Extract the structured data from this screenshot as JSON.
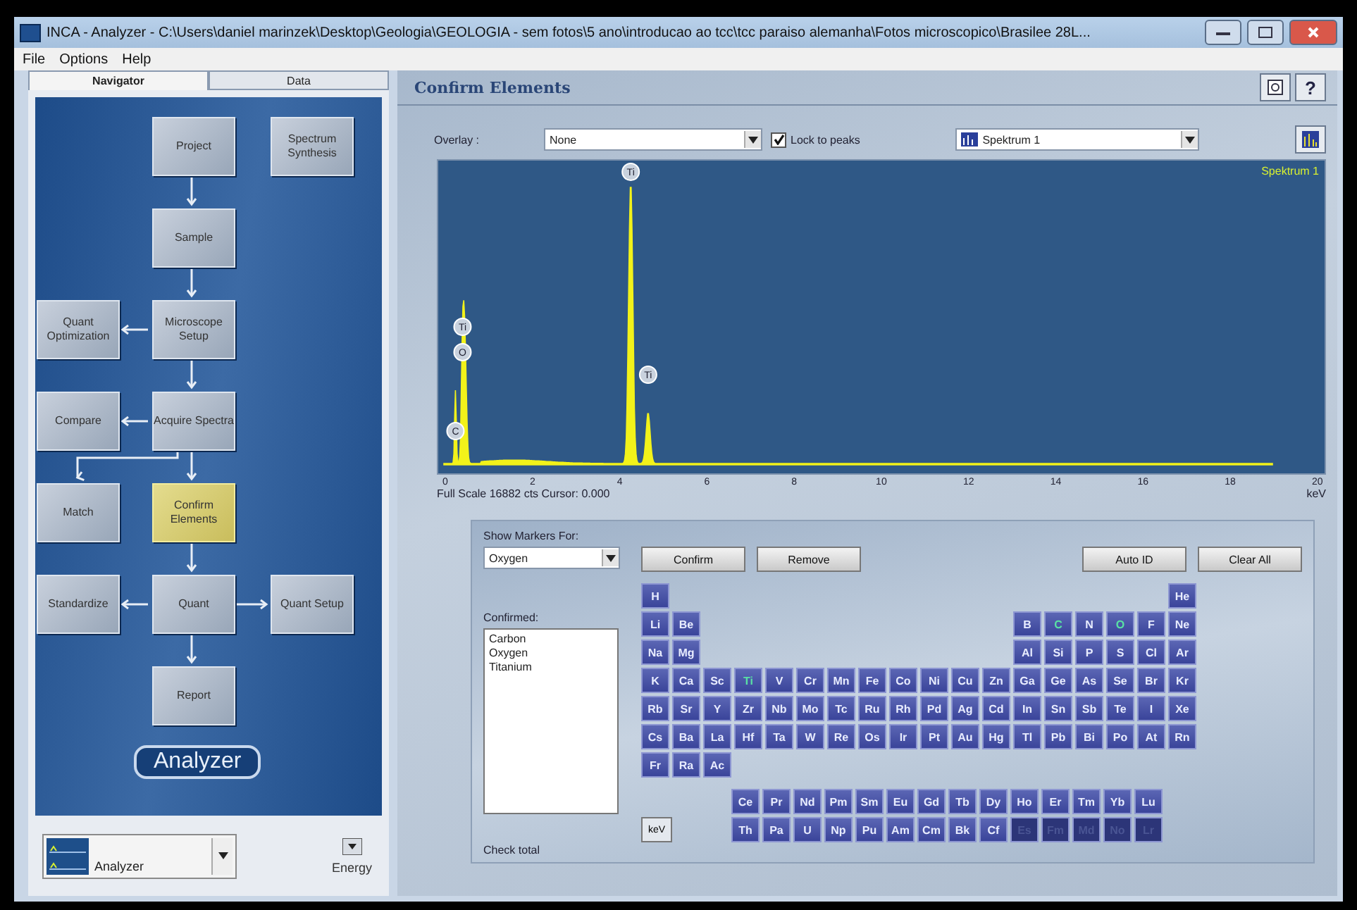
{
  "window": {
    "title": "INCA - Analyzer - C:\\Users\\daniel marinzek\\Desktop\\Geologia\\GEOLOGIA - sem fotos\\5 ano\\introducao ao tcc\\tcc paraiso alemanha\\Fotos microscopico\\Brasilee 28L..."
  },
  "menu": [
    "File",
    "Options",
    "Help"
  ],
  "side_tabs": [
    {
      "label": "Navigator",
      "selected": true
    },
    {
      "label": "Data",
      "selected": false
    }
  ],
  "navigator": {
    "nodes": [
      {
        "label": "Project",
        "selected": false
      },
      {
        "label": "Spectrum Synthesis",
        "selected": false
      },
      {
        "label": "Sample",
        "selected": false
      },
      {
        "label": "Quant Optimization",
        "selected": false
      },
      {
        "label": "Microscope Setup",
        "selected": false
      },
      {
        "label": "Compare",
        "selected": false
      },
      {
        "label": "Acquire Spectra",
        "selected": false
      },
      {
        "label": "Match",
        "selected": false
      },
      {
        "label": "Confirm Elements",
        "selected": true
      },
      {
        "label": "Standardize",
        "selected": false
      },
      {
        "label": "Quant",
        "selected": false
      },
      {
        "label": "Quant Setup",
        "selected": false
      },
      {
        "label": "Report",
        "selected": false
      }
    ],
    "logo": "Analyzer"
  },
  "app_select": "Analyzer",
  "energy_button": "Energy",
  "panel": {
    "title": "Confirm Elements",
    "help": "?"
  },
  "overlay": {
    "label": "Overlay :",
    "value": "None"
  },
  "lock_to_peaks": {
    "label": "Lock to peaks",
    "checked": true
  },
  "spectrum_select": "Spektrum  1",
  "spectrum": {
    "legend": "Spektrum  1",
    "x_ticks": [
      "0",
      "2",
      "4",
      "6",
      "8",
      "10",
      "12",
      "14",
      "16",
      "18",
      "20"
    ],
    "scale": "Full Scale 16882 cts Cursor: 0.000",
    "unit": "keV",
    "peak_labels": [
      {
        "label": "C"
      },
      {
        "label": "O"
      },
      {
        "label": "Ti"
      },
      {
        "label": "Ti"
      },
      {
        "label": "Ti"
      }
    ]
  },
  "markers": {
    "label": "Show Markers For:",
    "value": "Oxygen"
  },
  "buttons": [
    {
      "label": "Confirm"
    },
    {
      "label": "Remove"
    },
    {
      "label": "Auto ID"
    },
    {
      "label": "Clear All"
    }
  ],
  "confirmed": {
    "label": "Confirmed:",
    "items": [
      "Carbon",
      "Oxygen",
      "Titanium"
    ]
  },
  "check_total": "Check total",
  "kev_button": "keV",
  "periodic_table": {
    "rows": [
      [
        {
          "s": "H"
        },
        "",
        "",
        "",
        "",
        "",
        "",
        "",
        "",
        "",
        "",
        "",
        "",
        "",
        "",
        "",
        "",
        {
          "s": "He"
        }
      ],
      [
        {
          "s": "Li"
        },
        {
          "s": "Be"
        },
        "",
        "",
        "",
        "",
        "",
        "",
        "",
        "",
        "",
        "",
        {
          "s": "B"
        },
        {
          "s": "C",
          "confirmed": true
        },
        {
          "s": "N"
        },
        {
          "s": "O",
          "confirmed": true
        },
        {
          "s": "F"
        },
        {
          "s": "Ne"
        }
      ],
      [
        {
          "s": "Na"
        },
        {
          "s": "Mg"
        },
        "",
        "",
        "",
        "",
        "",
        "",
        "",
        "",
        "",
        "",
        {
          "s": "Al"
        },
        {
          "s": "Si"
        },
        {
          "s": "P"
        },
        {
          "s": "S"
        },
        {
          "s": "Cl"
        },
        {
          "s": "Ar"
        }
      ],
      [
        {
          "s": "K"
        },
        {
          "s": "Ca"
        },
        {
          "s": "Sc"
        },
        {
          "s": "Ti",
          "confirmed": true
        },
        {
          "s": "V"
        },
        {
          "s": "Cr"
        },
        {
          "s": "Mn"
        },
        {
          "s": "Fe"
        },
        {
          "s": "Co"
        },
        {
          "s": "Ni"
        },
        {
          "s": "Cu"
        },
        {
          "s": "Zn"
        },
        {
          "s": "Ga"
        },
        {
          "s": "Ge"
        },
        {
          "s": "As"
        },
        {
          "s": "Se"
        },
        {
          "s": "Br"
        },
        {
          "s": "Kr"
        }
      ],
      [
        {
          "s": "Rb"
        },
        {
          "s": "Sr"
        },
        {
          "s": "Y"
        },
        {
          "s": "Zr"
        },
        {
          "s": "Nb"
        },
        {
          "s": "Mo"
        },
        {
          "s": "Tc"
        },
        {
          "s": "Ru"
        },
        {
          "s": "Rh"
        },
        {
          "s": "Pd"
        },
        {
          "s": "Ag"
        },
        {
          "s": "Cd"
        },
        {
          "s": "In"
        },
        {
          "s": "Sn"
        },
        {
          "s": "Sb"
        },
        {
          "s": "Te"
        },
        {
          "s": "I"
        },
        {
          "s": "Xe"
        }
      ],
      [
        {
          "s": "Cs"
        },
        {
          "s": "Ba"
        },
        {
          "s": "La"
        },
        {
          "s": "Hf"
        },
        {
          "s": "Ta"
        },
        {
          "s": "W"
        },
        {
          "s": "Re"
        },
        {
          "s": "Os"
        },
        {
          "s": "Ir"
        },
        {
          "s": "Pt"
        },
        {
          "s": "Au"
        },
        {
          "s": "Hg"
        },
        {
          "s": "Tl"
        },
        {
          "s": "Pb"
        },
        {
          "s": "Bi"
        },
        {
          "s": "Po"
        },
        {
          "s": "At"
        },
        {
          "s": "Rn"
        }
      ],
      [
        {
          "s": "Fr"
        },
        {
          "s": "Ra"
        },
        {
          "s": "Ac"
        }
      ]
    ],
    "f_rows": [
      [
        {
          "s": "Ce"
        },
        {
          "s": "Pr"
        },
        {
          "s": "Nd"
        },
        {
          "s": "Pm"
        },
        {
          "s": "Sm"
        },
        {
          "s": "Eu"
        },
        {
          "s": "Gd"
        },
        {
          "s": "Tb"
        },
        {
          "s": "Dy"
        },
        {
          "s": "Ho"
        },
        {
          "s": "Er"
        },
        {
          "s": "Tm"
        },
        {
          "s": "Yb"
        },
        {
          "s": "Lu"
        }
      ],
      [
        {
          "s": "Th"
        },
        {
          "s": "Pa"
        },
        {
          "s": "U"
        },
        {
          "s": "Np"
        },
        {
          "s": "Pu"
        },
        {
          "s": "Am"
        },
        {
          "s": "Cm"
        },
        {
          "s": "Bk"
        },
        {
          "s": "Cf"
        },
        {
          "s": "Es",
          "disabled": true
        },
        {
          "s": "Fm",
          "disabled": true
        },
        {
          "s": "Md",
          "disabled": true
        },
        {
          "s": "No",
          "disabled": true
        },
        {
          "s": "Lr",
          "disabled": true
        }
      ]
    ]
  }
}
